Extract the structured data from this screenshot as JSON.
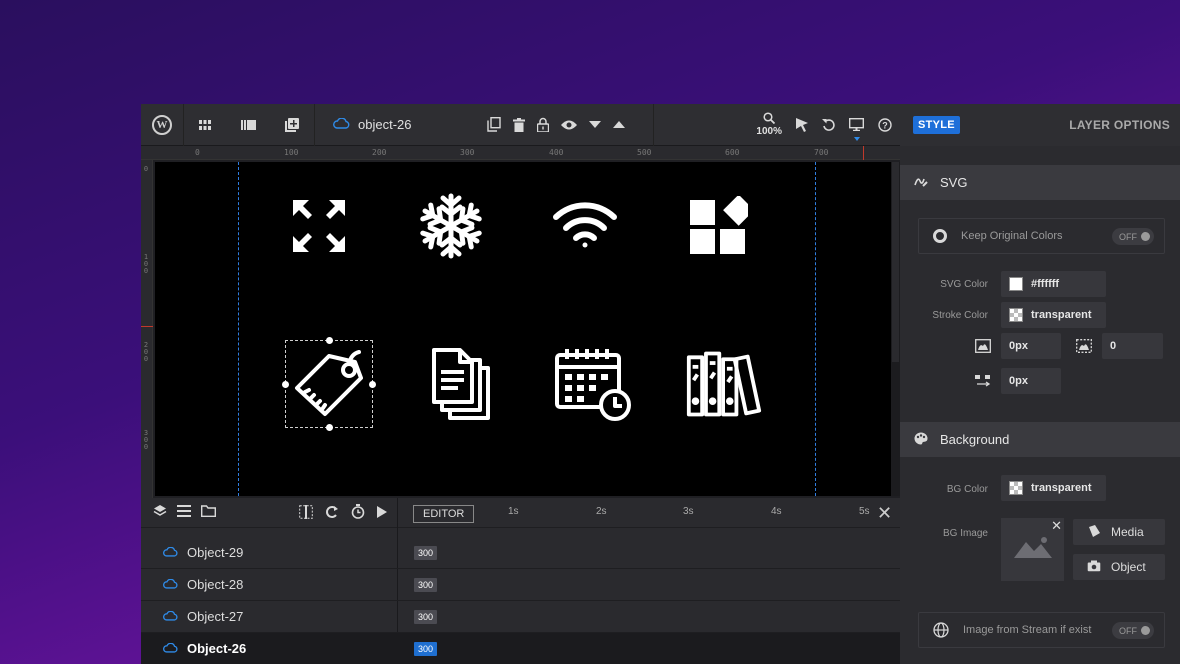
{
  "toolbar": {
    "object_name": "object-26",
    "zoom_label": "100%"
  },
  "ruler": {
    "h_ticks": [
      "0",
      "100",
      "200",
      "300",
      "400",
      "500",
      "600",
      "700"
    ],
    "v_ticks": [
      "0",
      "1\n0\n0",
      "2\n0\n0",
      "3\n0\n0"
    ]
  },
  "canvas": {
    "icons": [
      "expand-arrows-icon",
      "snowflake-icon",
      "wifi-icon",
      "shapes-grid-icon",
      "price-tag-icon",
      "documents-icon",
      "calendar-clock-icon",
      "binders-icon"
    ],
    "icon_color": "#ffffff"
  },
  "timeline": {
    "editor_label": "EDITOR",
    "scale": [
      "1s",
      "2s",
      "3s",
      "4s",
      "5s"
    ],
    "rows": [
      {
        "name": "Object-29",
        "duration": "300",
        "active": false
      },
      {
        "name": "Object-28",
        "duration": "300",
        "active": false
      },
      {
        "name": "Object-27",
        "duration": "300",
        "active": false
      },
      {
        "name": "Object-26",
        "duration": "300",
        "active": true
      }
    ]
  },
  "panel": {
    "style_tab": "STYLE",
    "layer_options_tab": "LAYER OPTIONS",
    "svg_section": "SVG",
    "keep_colors_label": "Keep Original Colors",
    "keep_colors_state": "OFF",
    "svg_color_label": "SVG Color",
    "svg_color_value": "#ffffff",
    "stroke_color_label": "Stroke Color",
    "stroke_color_value": "transparent",
    "stroke_width_value": "0px",
    "stroke_dash_value": "0",
    "stroke_offset_value": "0px",
    "background_section": "Background",
    "bg_color_label": "BG Color",
    "bg_color_value": "transparent",
    "bg_image_label": "BG Image",
    "media_button": "Media",
    "object_button": "Object",
    "stream_label": "Image from Stream if exist",
    "stream_state": "OFF"
  },
  "colors": {
    "accent": "#1e6fd9",
    "guide": "#2f7de0"
  }
}
